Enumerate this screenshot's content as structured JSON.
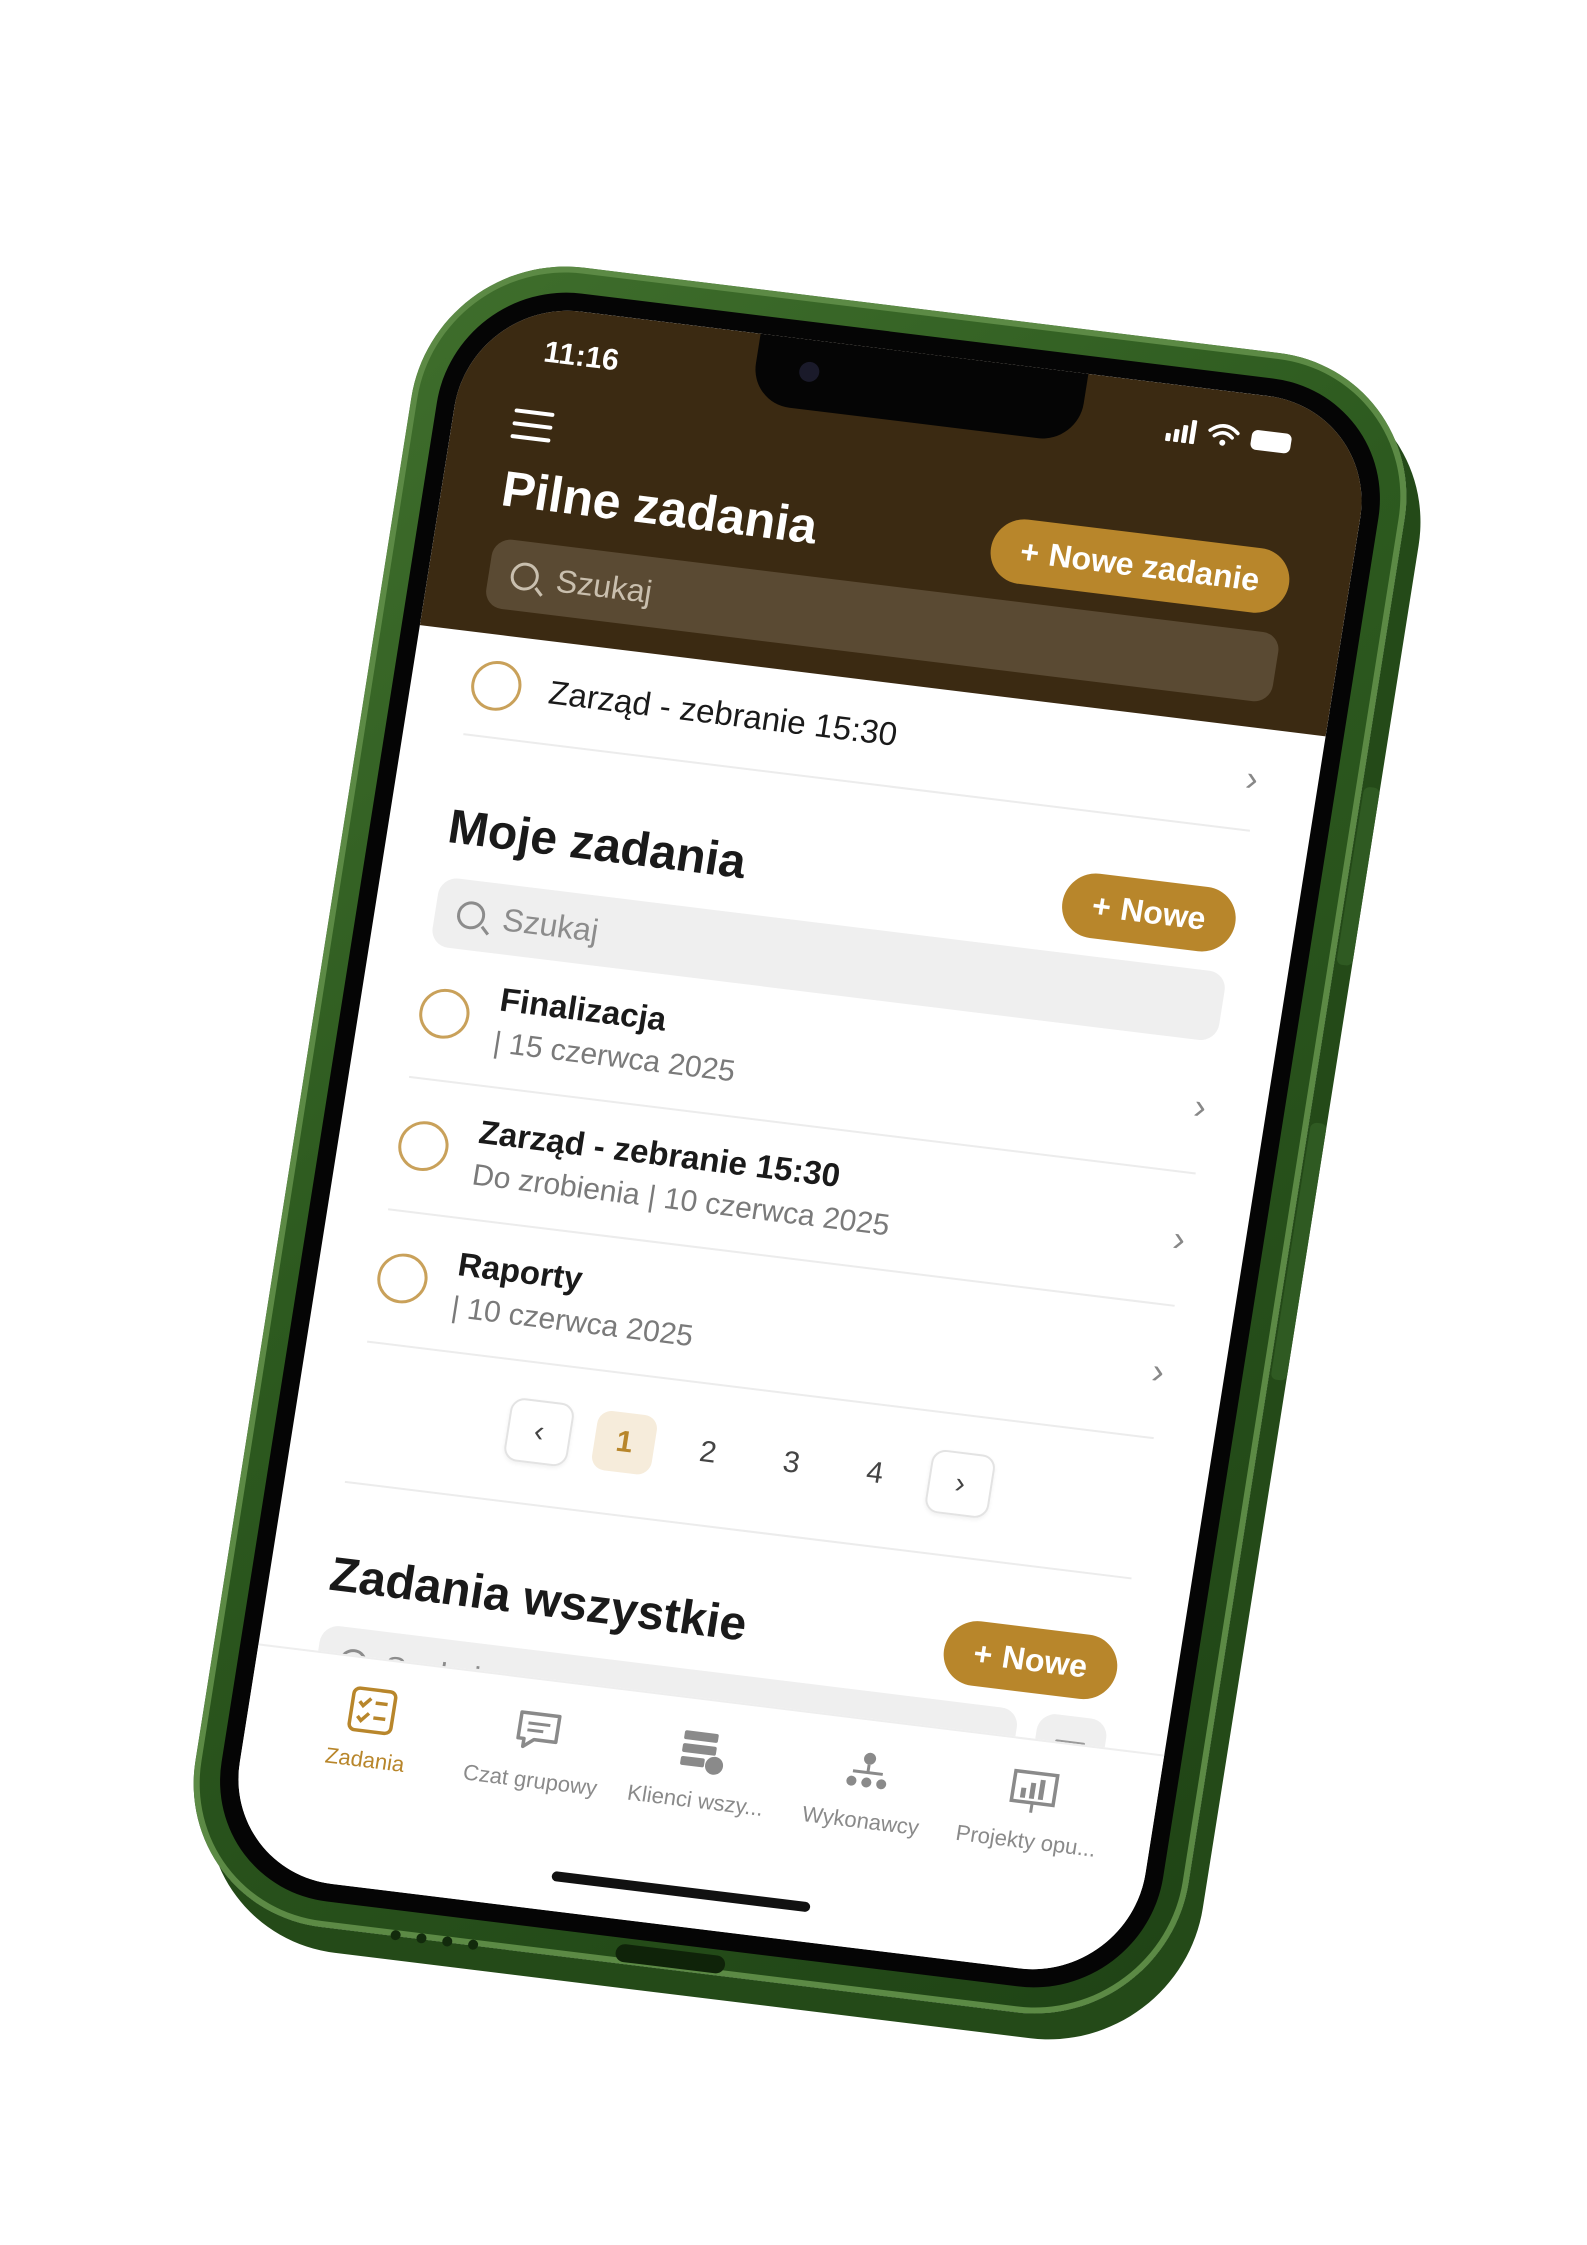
{
  "status_bar": {
    "time": "11:16"
  },
  "urgent": {
    "title": "Pilne zadania",
    "new_button_label": "Nowe zadanie",
    "search_placeholder": "Szukaj",
    "tasks": [
      {
        "name": "Zarząd - zebranie 15:30"
      }
    ]
  },
  "my_tasks": {
    "title": "Moje zadania",
    "new_button_label": "Nowe",
    "search_placeholder": "Szukaj",
    "tasks": [
      {
        "name": "Finalizacja",
        "meta": "| 15 czerwca 2025"
      },
      {
        "name": "Zarząd - zebranie 15:30",
        "meta": "Do zrobienia | 10 czerwca 2025"
      },
      {
        "name": "Raporty",
        "meta": "| 10 czerwca 2025"
      }
    ],
    "pagination": {
      "prev": "‹",
      "next": "›",
      "pages": [
        "1",
        "2",
        "3",
        "4"
      ],
      "current": "1"
    }
  },
  "all_tasks": {
    "title": "Zadania wszystkie",
    "new_button_label": "Nowe",
    "search_placeholder": "Szukaj"
  },
  "tabbar": {
    "items": [
      {
        "label": "Zadania",
        "icon": "tasks-icon",
        "active": true
      },
      {
        "label": "Czat grupowy",
        "icon": "chat-icon",
        "active": false
      },
      {
        "label": "Klienci wszy...",
        "icon": "clients-icon",
        "active": false
      },
      {
        "label": "Wykonawcy",
        "icon": "contractors-icon",
        "active": false
      },
      {
        "label": "Projekty opu...",
        "icon": "projects-icon",
        "active": false
      }
    ]
  },
  "colors": {
    "header_bg": "#3b2a12",
    "accent_gold": "#b8862b",
    "phone_green": "#2d5a1f"
  }
}
